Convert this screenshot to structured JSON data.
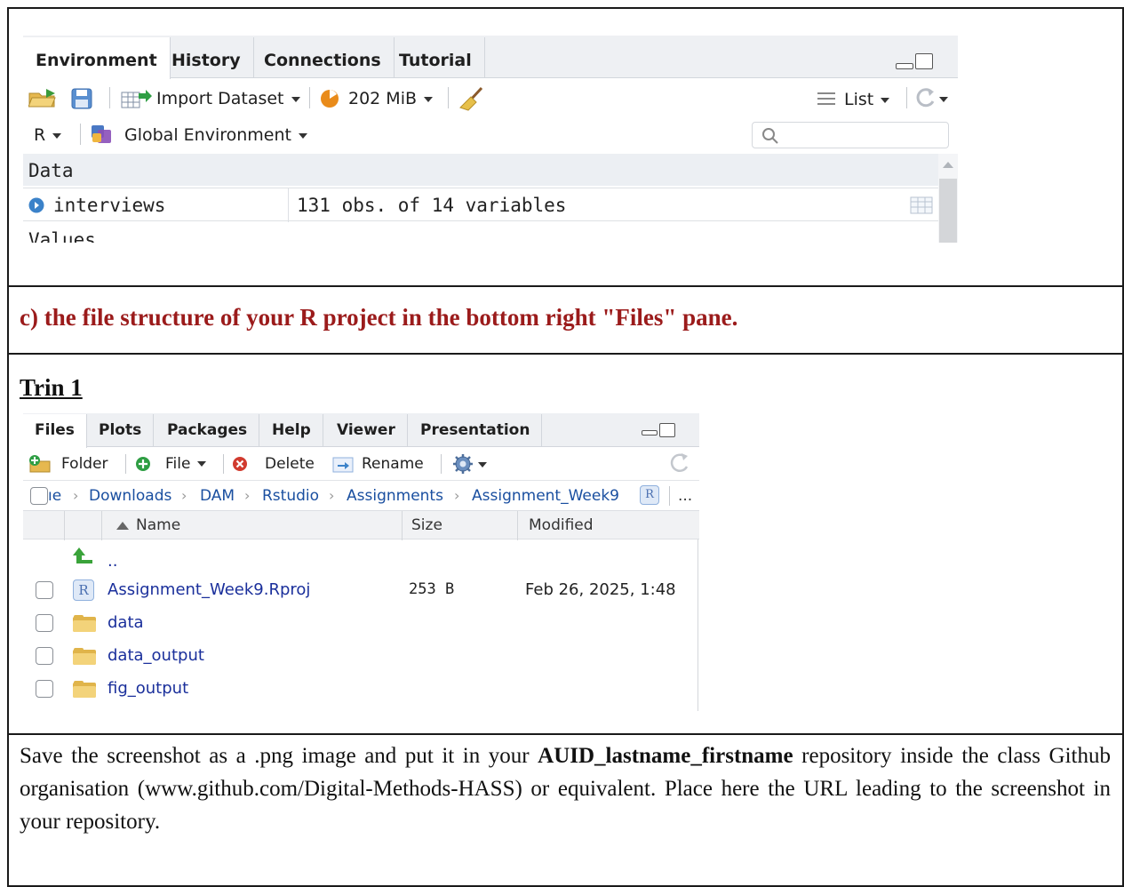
{
  "environment_pane": {
    "tabs": [
      "Environment",
      "History",
      "Connections",
      "Tutorial"
    ],
    "toolbar": {
      "import_dataset": "Import Dataset",
      "memory": "202 MiB",
      "view_mode": "List"
    },
    "toolbar2": {
      "language": "R",
      "scope": "Global Environment",
      "search_placeholder": ""
    },
    "sections": {
      "data": "Data",
      "values": "Values"
    },
    "rows": [
      {
        "name": "interviews",
        "value": "131 obs. of 14 variables"
      }
    ],
    "colors": {
      "tab_bar": "#eef0f3",
      "section_bg": "#eceff3"
    }
  },
  "question": "c) the file structure of your R project in the bottom right \"Files\" pane.",
  "trin_label": "Trin 1",
  "files_pane": {
    "tabs": [
      "Files",
      "Plots",
      "Packages",
      "Help",
      "Viewer",
      "Presentation"
    ],
    "toolbar": {
      "folder": "Folder",
      "file": "File",
      "delete": "Delete",
      "rename": "Rename"
    },
    "breadcrumb": {
      "lead": "ıe",
      "items": [
        "Downloads",
        "DAM",
        "Rstudio",
        "Assignments",
        "Assignment_Week9"
      ],
      "more": "..."
    },
    "columns": {
      "name": "Name",
      "size": "Size",
      "modified": "Modified"
    },
    "parent": "..",
    "rows": [
      {
        "name": "Assignment_Week9.Rproj",
        "size": "253 B",
        "modified": "Feb 26, 2025, 1:48",
        "type": "rproj"
      },
      {
        "name": "data",
        "size": "",
        "modified": "",
        "type": "folder"
      },
      {
        "name": "data_output",
        "size": "",
        "modified": "",
        "type": "folder"
      },
      {
        "name": "fig_output",
        "size": "",
        "modified": "",
        "type": "folder"
      }
    ],
    "colors": {
      "link": "#1a2f9b",
      "crumb": "#1a4fa0"
    }
  },
  "instructions": {
    "part1": "Save the screenshot as a .png image and put it in your ",
    "bold": "AUID_lastname_firstname",
    "part2": " repository inside the class Github organisation (www.github.com/Digital-Methods-HASS) or equivalent. Place here the URL leading to the screenshot in your repository."
  },
  "colors": {
    "question_red": "#9b1b1b",
    "border": "#1a1a1a"
  }
}
